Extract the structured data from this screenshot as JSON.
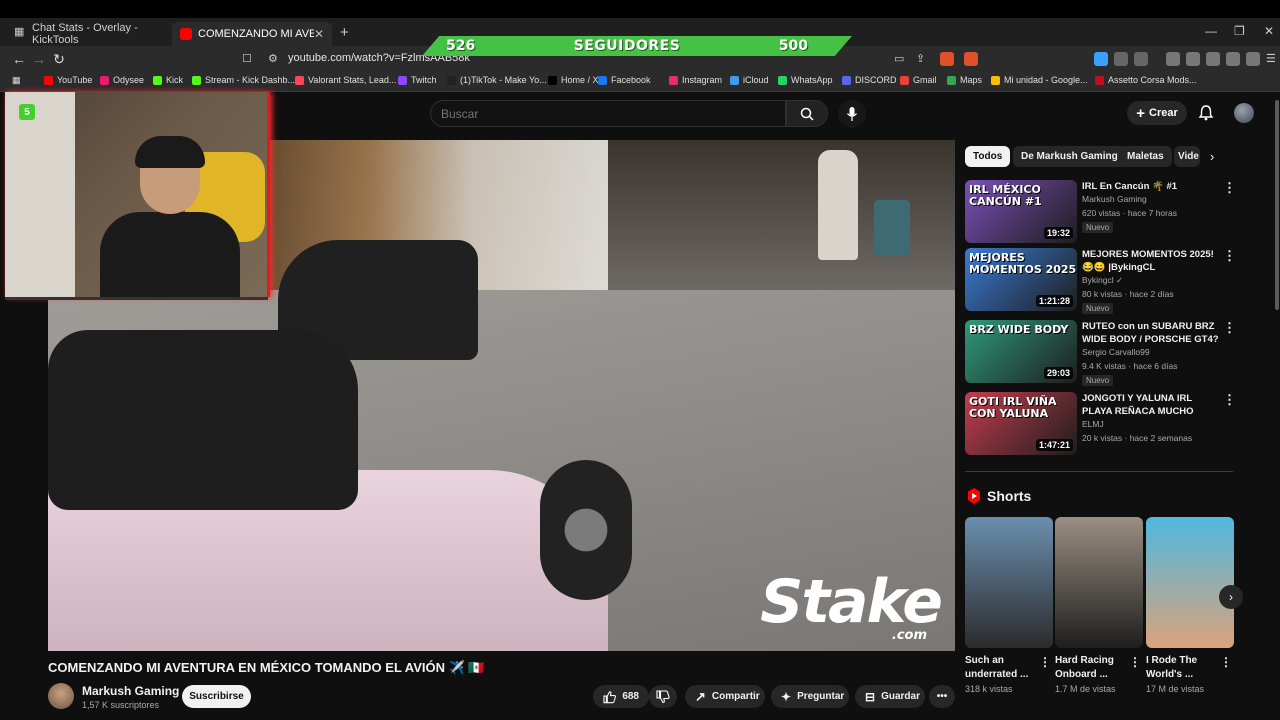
{
  "browser": {
    "tabs": [
      {
        "label": "Chat Stats - Overlay - KickTools"
      },
      {
        "label": "COMENZANDO MI AVENTURA EN MÉXICO"
      }
    ],
    "url": "youtube.com/watch?v=FzlmsAAB58k",
    "bookmarks": [
      {
        "label": "YouTube",
        "color": "#ff0000"
      },
      {
        "label": "Odysee",
        "color": "#ef1970"
      },
      {
        "label": "Kick",
        "color": "#53fc18"
      },
      {
        "label": "Stream - Kick Dashb...",
        "color": "#53fc18"
      },
      {
        "label": "Valorant Stats, Lead...",
        "color": "#ff4655"
      },
      {
        "label": "Twitch",
        "color": "#9146ff"
      },
      {
        "label": "(1)TikTok - Make Yo...",
        "color": "#222222"
      },
      {
        "label": "Home / X",
        "color": "#000000"
      },
      {
        "label": "Facebook",
        "color": "#1877f2"
      },
      {
        "label": "Instagram",
        "color": "#e1306c"
      },
      {
        "label": "iCloud",
        "color": "#3d9bf2"
      },
      {
        "label": "WhatsApp",
        "color": "#25d366"
      },
      {
        "label": "DISCORD",
        "color": "#5865f2"
      },
      {
        "label": "Gmail",
        "color": "#ea4335"
      },
      {
        "label": "Maps",
        "color": "#34a853"
      },
      {
        "label": "Mi unidad - Google...",
        "color": "#fbbc04"
      },
      {
        "label": "Assetto Corsa Mods...",
        "color": "#c0101a"
      }
    ]
  },
  "overlay": {
    "followers_current": "526",
    "followers_label": "SEGUIDORES",
    "followers_goal": "500",
    "webcam_badge": "5"
  },
  "youtube": {
    "search_placeholder": "Buscar",
    "create_label": "Crear",
    "video": {
      "title": "COMENZANDO MI AVENTURA EN MÉXICO TOMANDO EL AVIÓN ✈️ 🇲🇽",
      "channel": "Markush Gaming",
      "subscribers": "1,57 K suscriptores",
      "subscribe_label": "Suscribirse",
      "likes": "688",
      "share_label": "Compartir",
      "ask_label": "Preguntar",
      "save_label": "Guardar",
      "watermark_main": "Stake",
      "watermark_sub": ".com"
    },
    "chips": [
      "Todos",
      "De Markush Gaming",
      "Maletas",
      "Vide"
    ],
    "recommendations": [
      {
        "title": "IRL En Cancún 🌴 #1",
        "channel": "Markush Gaming",
        "meta": "620 vistas · hace 7 horas",
        "badge": "Nuevo",
        "duration": "19:32",
        "thumb_text": "IRL MÉXICO CANCÚN #1",
        "thumb_color": "#7b4fb8"
      },
      {
        "title": "MEJORES MOMENTOS 2025! 😂😄 |BykingCL",
        "channel": "Bykingcl ✓",
        "meta": "80 k vistas · hace 2 días",
        "badge": "Nuevo",
        "duration": "1:21:28",
        "thumb_text": "MEJORES MOMENTOS 2025",
        "thumb_color": "#3a7bd5"
      },
      {
        "title": "RUTEO con un SUBARU BRZ WIDE BODY / PORSCHE GT4? ...",
        "channel": "Sergio Carvallo99",
        "meta": "9.4 K vistas · hace 6 días",
        "badge": "Nuevo",
        "duration": "29:03",
        "thumb_text": "BRZ WIDE BODY",
        "thumb_color": "#2f9a7a"
      },
      {
        "title": "JONGOTI Y YALUNA IRL PLAYA REÑACA MUCHO PELUCHE ...",
        "channel": "ELMJ",
        "meta": "20 k vistas · hace 2 semanas",
        "badge": "",
        "duration": "1:47:21",
        "thumb_text": "GOTI IRL VIÑA CON YALUNA",
        "thumb_color": "#c43d4d"
      }
    ],
    "shorts_label": "Shorts",
    "shorts": [
      {
        "title": "Such an underrated ...",
        "views": "318 k vistas",
        "color1": "#6a8fb0",
        "color2": "#2b2b2b"
      },
      {
        "title": "Hard Racing Onboard ...",
        "views": "1.7 M de vistas",
        "color1": "#9b8f82",
        "color2": "#1e1e1e"
      },
      {
        "title": "I Rode The World's ...",
        "views": "17 M de vistas",
        "color1": "#4fb8e0",
        "color2": "#d9a37b"
      }
    ]
  }
}
